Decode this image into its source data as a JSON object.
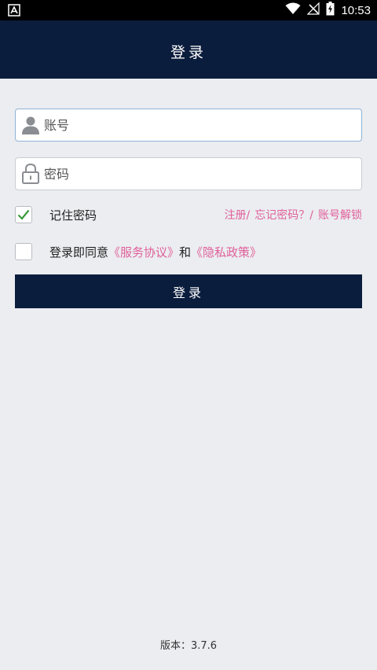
{
  "status_bar": {
    "time": "10:53",
    "icons": [
      "notification-a-icon",
      "wifi-icon",
      "no-signal-icon",
      "battery-charging-icon"
    ]
  },
  "header": {
    "title": "登录"
  },
  "form": {
    "account_placeholder": "账号",
    "password_placeholder": "密码",
    "remember_label": "记住密码",
    "remember_checked": true,
    "register_link": "注册/",
    "forgot_link": "忘记密码？/",
    "unlock_link": "账号解锁",
    "agree_prefix": "登录即同意",
    "service_agreement": "《服务协议》",
    "agree_and": "和",
    "privacy_policy": "《隐私政策》",
    "agree_checked": false,
    "login_button": "登录"
  },
  "footer": {
    "version": "版本：3.7.6"
  },
  "colors": {
    "header_bg": "#0b1d3d",
    "page_bg": "#ebedf1",
    "link_pink": "#e0609a",
    "check_green": "#3a9a3a"
  }
}
